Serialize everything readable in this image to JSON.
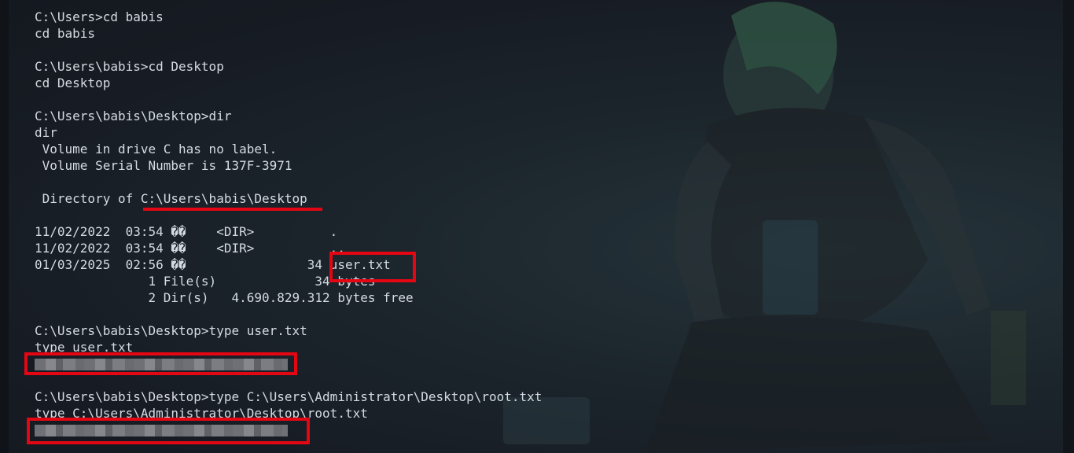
{
  "terminal": {
    "lines": [
      "C:\\Users>cd babis",
      "cd babis",
      "",
      "C:\\Users\\babis>cd Desktop",
      "cd Desktop",
      "",
      "C:\\Users\\babis\\Desktop>dir",
      "dir",
      " Volume in drive C has no label.",
      " Volume Serial Number is 137F-3971",
      "",
      " Directory of C:\\Users\\babis\\Desktop",
      "",
      "11/02/2022  03:54 ��    <DIR>          .",
      "11/02/2022  03:54 ��    <DIR>          ..",
      "01/03/2025  02:56 ��                34 user.txt",
      "               1 File(s)             34 bytes",
      "               2 Dir(s)   4.690.829.312 bytes free",
      "",
      "C:\\Users\\babis\\Desktop>type user.txt",
      "type user.txt",
      "",
      "",
      "C:\\Users\\babis\\Desktop>type C:\\Users\\Administrator\\Desktop\\root.txt",
      "type C:\\Users\\Administrator\\Desktop\\root.txt",
      ""
    ],
    "redacted_rows": [
      21,
      25
    ]
  },
  "colors": {
    "text": "#d6dbe3",
    "background": "#1b1f27",
    "highlight": "#e40613",
    "redaction": "#75777c"
  }
}
